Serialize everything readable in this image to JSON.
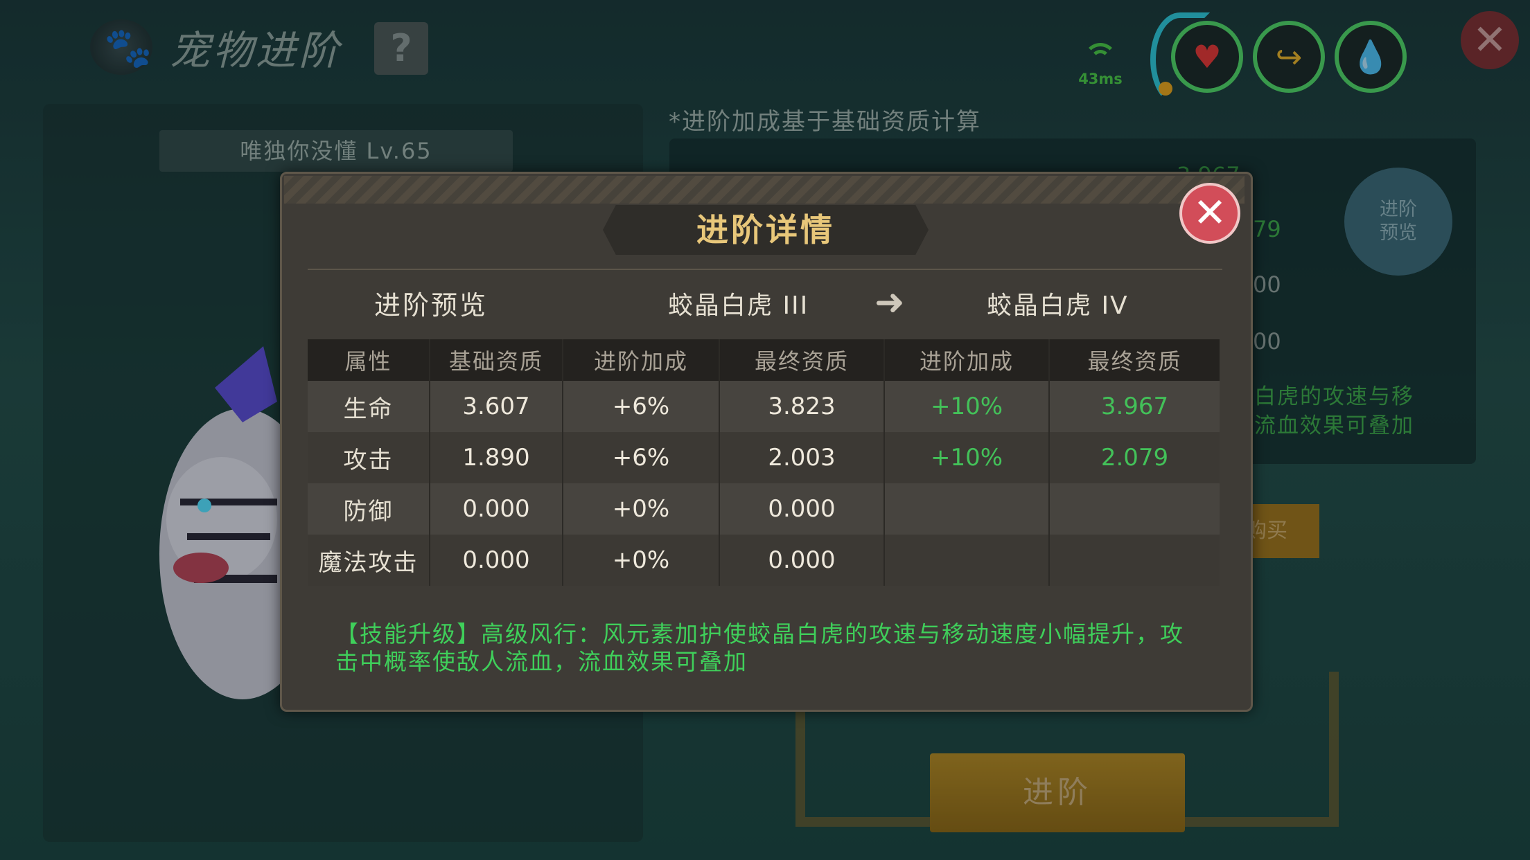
{
  "header": {
    "title": "宠物进阶",
    "help_label": "?",
    "ping_label": "43ms",
    "status_icons": [
      "heart-icon",
      "arm-icon",
      "water-drop-icon"
    ],
    "close_label": "✕"
  },
  "pet": {
    "name_label": "唯独你没懂 Lv.65"
  },
  "panel": {
    "note": "*进阶加成基于基础资质计算",
    "preview_button": "进阶\n预览",
    "values": [
      "3.967",
      "79",
      "00",
      "00"
    ],
    "skill_tail": "白虎的攻速与移\n流血效果可叠加",
    "buy_label": "购买",
    "advance_button": "进阶"
  },
  "modal": {
    "title": "进阶详情",
    "close_label": "✕",
    "preview_label": "进阶预览",
    "from_stage": "蛟晶白虎 III",
    "to_stage": "蛟晶白虎 IV",
    "table": {
      "headers": [
        "属性",
        "基础资质",
        "进阶加成",
        "最终资质",
        "进阶加成",
        "最终资质"
      ],
      "rows": [
        [
          "生命",
          "3.607",
          "+6%",
          "3.823",
          "+10%",
          "3.967"
        ],
        [
          "攻击",
          "1.890",
          "+6%",
          "2.003",
          "+10%",
          "2.079"
        ],
        [
          "防御",
          "0.000",
          "+0%",
          "0.000",
          "",
          ""
        ],
        [
          "魔法攻击",
          "0.000",
          "+0%",
          "0.000",
          "",
          ""
        ]
      ]
    },
    "skill_text": "【技能升级】高级风行：风元素加护使蛟晶白虎的攻速与移动速度小幅提升，攻击中概率使敌人流血，流血效果可叠加"
  },
  "colors": {
    "accent_gold": "#e8c77a",
    "green_value": "#43c159",
    "close_red": "#d24d59"
  }
}
